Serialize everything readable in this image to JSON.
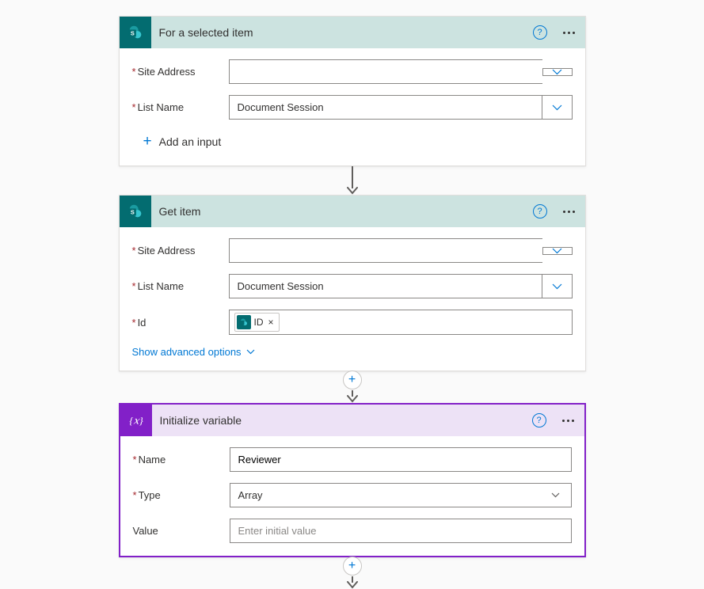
{
  "actions": {
    "selected_item": {
      "title": "For a selected item",
      "site_address_label": "Site Address",
      "site_address_value": "",
      "list_name_label": "List Name",
      "list_name_value": "Document Session",
      "add_input": "Add an input"
    },
    "get_item": {
      "title": "Get item",
      "site_address_label": "Site Address",
      "site_address_value": "",
      "list_name_label": "List Name",
      "list_name_value": "Document Session",
      "id_label": "Id",
      "id_token": "ID",
      "advanced": "Show advanced options"
    },
    "init_var": {
      "title": "Initialize variable",
      "name_label": "Name",
      "name_value": "Reviewer",
      "type_label": "Type",
      "type_value": "Array",
      "value_label": "Value",
      "value_placeholder": "Enter initial value"
    }
  }
}
